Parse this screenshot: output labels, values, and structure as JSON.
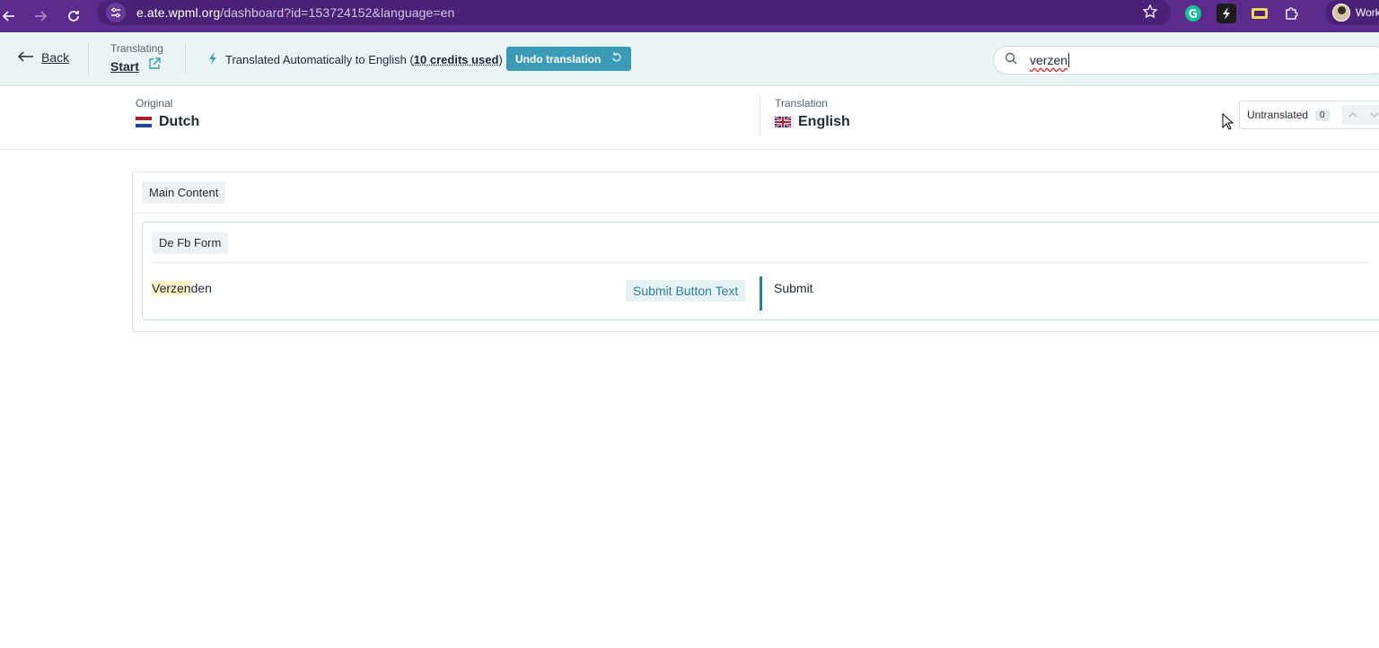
{
  "browser": {
    "url_host": "e.ate.wpml.org",
    "url_path": "/dashboard?id=153724152&language=en",
    "profile_label": "Work"
  },
  "toolbar": {
    "back_label": "Back",
    "translating_label": "Translating",
    "translating_title": "Start",
    "auto_prefix": "Translated Automatically to English (",
    "credits": "10 credits used",
    "auto_suffix": ")",
    "undo_label": "Undo translation",
    "search_value": "verzen"
  },
  "languages": {
    "original_label": "Original",
    "original_name": "Dutch",
    "translation_label": "Translation",
    "translation_name": "English",
    "filter_label": "Untranslated",
    "filter_count": "0"
  },
  "content": {
    "section_label": "Main Content",
    "group_label": "De Fb Form",
    "segment": {
      "source_highlight": "Verzen",
      "source_rest": "den",
      "field_label": "Submit Button Text",
      "target": "Submit"
    }
  },
  "colors": {
    "browser_frame": "#5b2c8e",
    "toolbar_bg": "#eaf3f6",
    "accent": "#3b9bb4",
    "highlight": "#fdf1c7"
  }
}
